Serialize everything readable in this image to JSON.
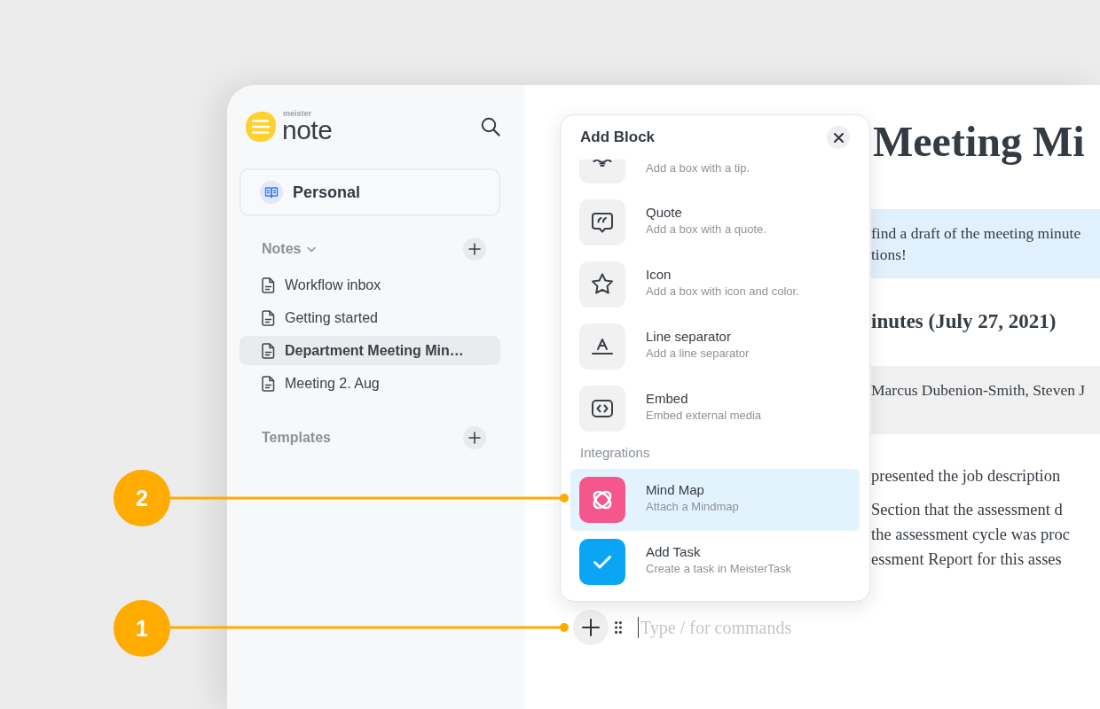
{
  "sidebar": {
    "logo": {
      "prefix": "meister",
      "name": "note"
    },
    "workspace": {
      "label": "Personal"
    },
    "notes_section": {
      "label": "Notes",
      "expanded": true,
      "items": [
        {
          "label": "Workflow inbox",
          "selected": false
        },
        {
          "label": "Getting started",
          "selected": false
        },
        {
          "label": "Department Meeting Min…",
          "selected": true
        },
        {
          "label": "Meeting 2. Aug",
          "selected": false
        }
      ]
    },
    "templates_section": {
      "label": "Templates"
    }
  },
  "editor": {
    "title": "Meeting Mi",
    "callout_lines": [
      "find a draft of the meeting minute",
      "tions!"
    ],
    "heading": "inutes (July 27, 2021)",
    "attendees": "Marcus Dubenion-Smith, Steven J",
    "paragraphs": [
      [
        "presented the job description"
      ],
      [
        "Section that the assessment d",
        "the assessment cycle was proc",
        "essment Report for this asses"
      ]
    ],
    "input": {
      "placeholder": "Type / for commands"
    }
  },
  "add_block_popup": {
    "title": "Add Block",
    "blocks": [
      {
        "kind": "tip",
        "description": "Add a box with a tip.",
        "selected": false
      },
      {
        "kind": "quote",
        "title": "Quote",
        "description": "Add a box with a quote.",
        "selected": false
      },
      {
        "kind": "icon",
        "title": "Icon",
        "description": "Add a box with icon and color.",
        "selected": false
      },
      {
        "kind": "separator",
        "title": "Line separator",
        "description": "Add a line separator",
        "selected": false
      },
      {
        "kind": "embed",
        "title": "Embed",
        "description": "Embed external media",
        "selected": false
      }
    ],
    "integrations_heading": "Integrations",
    "integrations": [
      {
        "kind": "mindmap",
        "title": "Mind Map",
        "description": "Attach a Mindmap",
        "color": "#f5568b",
        "selected": true
      },
      {
        "kind": "task",
        "title": "Add Task",
        "description": "Create a task in MeisterTask",
        "color": "#0aa5f5",
        "selected": false
      }
    ]
  },
  "annotations": [
    {
      "number": "2"
    },
    {
      "number": "1"
    }
  ]
}
